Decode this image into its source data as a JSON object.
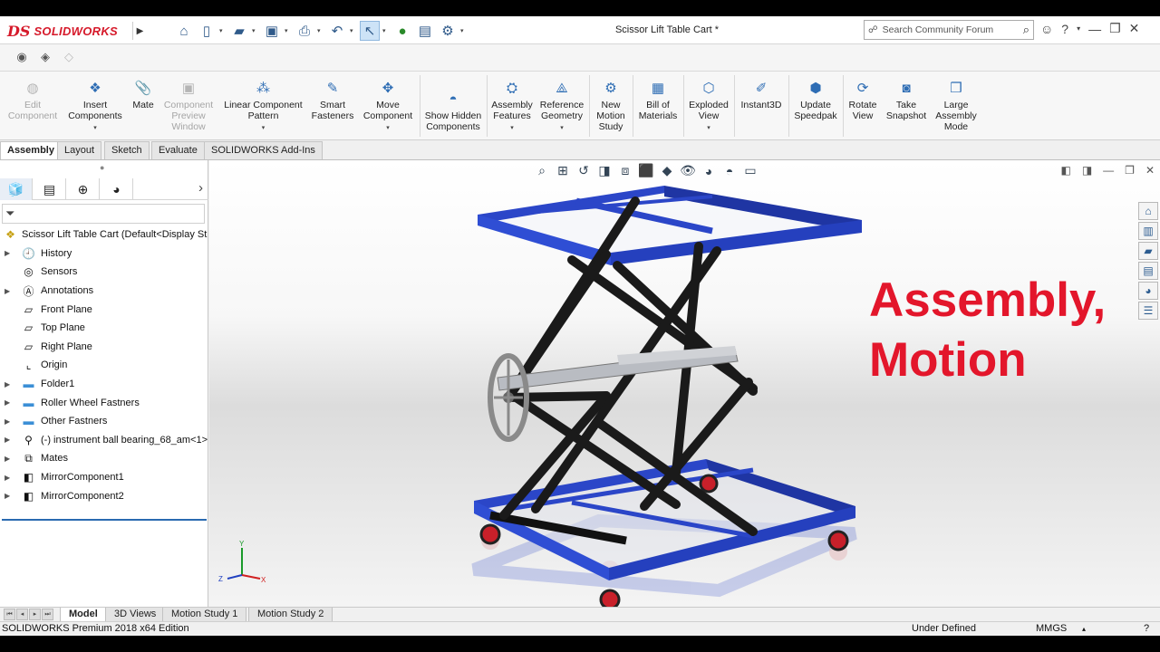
{
  "app": {
    "logo_text": "SOLIDWORKS",
    "logo_mark": "DS",
    "title": "Scissor Lift Table Cart *",
    "search_placeholder": "Search Community Forum"
  },
  "command_manager": [
    {
      "label": "Edit Component",
      "icon": "edit-component-icon",
      "disabled": true
    },
    {
      "label": "Insert Components",
      "icon": "insert-components-icon",
      "disabled": false
    },
    {
      "label": "Mate",
      "icon": "mate-icon",
      "disabled": false
    },
    {
      "label": "Component Preview Window",
      "icon": "preview-window-icon",
      "disabled": true
    },
    {
      "label": "Linear Component Pattern",
      "icon": "linear-pattern-icon",
      "disabled": false
    },
    {
      "label": "Smart Fasteners",
      "icon": "smart-fasteners-icon",
      "disabled": false
    },
    {
      "label": "Move Component",
      "icon": "move-component-icon",
      "disabled": false
    },
    {
      "label": "Show Hidden Components",
      "icon": "show-hidden-icon",
      "disabled": false
    },
    {
      "label": "Assembly Features",
      "icon": "assembly-features-icon",
      "disabled": false
    },
    {
      "label": "Reference Geometry",
      "icon": "reference-geometry-icon",
      "disabled": false
    },
    {
      "label": "New Motion Study",
      "icon": "motion-study-icon",
      "disabled": false
    },
    {
      "label": "Bill of Materials",
      "icon": "bom-icon",
      "disabled": false
    },
    {
      "label": "Exploded View",
      "icon": "exploded-view-icon",
      "disabled": false
    },
    {
      "label": "Instant3D",
      "icon": "instant3d-icon",
      "disabled": false
    },
    {
      "label": "Update Speedpak",
      "icon": "speedpak-icon",
      "disabled": false
    },
    {
      "label": "Rotate View",
      "icon": "rotate-view-icon",
      "disabled": false
    },
    {
      "label": "Take Snapshot",
      "icon": "snapshot-icon",
      "disabled": false
    },
    {
      "label": "Large Assembly Mode",
      "icon": "large-assembly-icon",
      "disabled": false
    }
  ],
  "tabs": [
    "Assembly",
    "Layout",
    "Sketch",
    "Evaluate",
    "SOLIDWORKS Add-Ins"
  ],
  "tree": {
    "root": "Scissor Lift Table Cart  (Default<Display St",
    "items": [
      {
        "label": "History",
        "icon": "history-icon",
        "expandable": true
      },
      {
        "label": "Sensors",
        "icon": "sensors-icon",
        "expandable": false
      },
      {
        "label": "Annotations",
        "icon": "annotations-icon",
        "expandable": true
      },
      {
        "label": "Front Plane",
        "icon": "plane-icon",
        "expandable": false
      },
      {
        "label": "Top Plane",
        "icon": "plane-icon",
        "expandable": false
      },
      {
        "label": "Right Plane",
        "icon": "plane-icon",
        "expandable": false
      },
      {
        "label": "Origin",
        "icon": "origin-icon",
        "expandable": false
      },
      {
        "label": "Folder1",
        "icon": "folder-icon",
        "expandable": true
      },
      {
        "label": "Roller Wheel Fastners",
        "icon": "folder-icon",
        "expandable": true
      },
      {
        "label": "Other Fastners",
        "icon": "folder-icon",
        "expandable": true
      },
      {
        "label": "(-) instrument ball bearing_68_am<1>",
        "icon": "part-icon",
        "expandable": true
      },
      {
        "label": "Mates",
        "icon": "mates-icon",
        "expandable": true
      },
      {
        "label": "MirrorComponent1",
        "icon": "mirror-component-icon",
        "expandable": true
      },
      {
        "label": "MirrorComponent2",
        "icon": "mirror-component-icon",
        "expandable": true
      }
    ]
  },
  "overlay": {
    "line1": "Assembly,",
    "line2": "Motion"
  },
  "bottom_tabs": [
    "Model",
    "3D Views",
    "Motion Study 1",
    "Motion Study 2"
  ],
  "status": {
    "left": "SOLIDWORKS Premium 2018 x64 Edition",
    "state": "Under Defined",
    "units": "MMGS"
  },
  "colors": {
    "frame_blue": "#2b46c8",
    "scissor_black": "#1a1a1a",
    "accent_red": "#e3162b"
  }
}
